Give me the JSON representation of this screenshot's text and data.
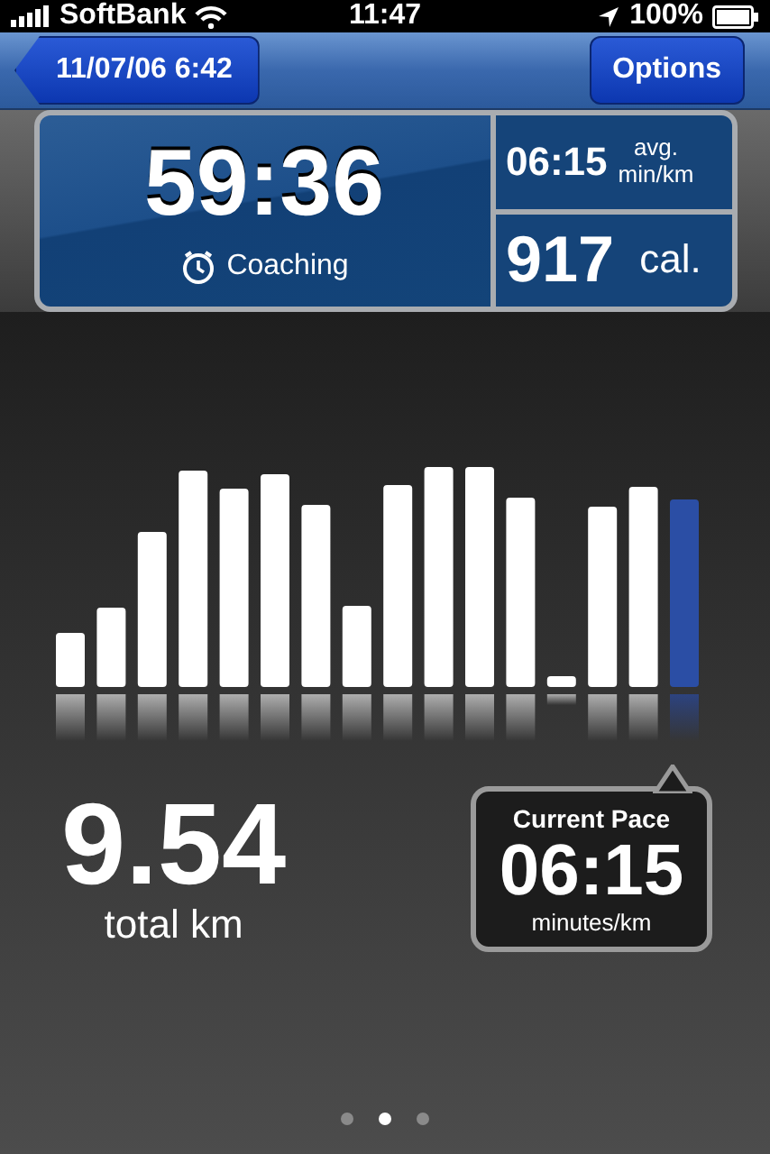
{
  "status_bar": {
    "carrier": "SoftBank",
    "time": "11:47",
    "battery": "100%"
  },
  "nav": {
    "back": "11/07/06 6:42",
    "action": "Options"
  },
  "summary": {
    "duration": "59:36",
    "mode": "Coaching",
    "avg_pace": "06:15",
    "avg_label_1": "avg.",
    "avg_label_2": "min/km",
    "calories": "917",
    "calories_unit": "cal."
  },
  "distance": {
    "value": "9.54",
    "unit": "total km"
  },
  "current_pace": {
    "title": "Current Pace",
    "value": "06:15",
    "unit": "minutes/km"
  },
  "pages": [
    {
      "selected": false
    },
    {
      "selected": true
    },
    {
      "selected": false
    }
  ]
}
